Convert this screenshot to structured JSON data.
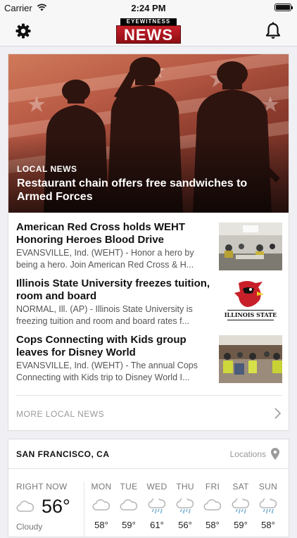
{
  "status_bar": {
    "carrier": "Carrier",
    "time": "2:24 PM"
  },
  "navbar": {
    "logo_top": "EYEWITNESS",
    "logo_main": "NEWS"
  },
  "hero": {
    "kicker": "LOCAL NEWS",
    "headline": "Restaurant chain offers free sandwiches to Armed Forces"
  },
  "stories": [
    {
      "title": "American Red Cross holds WEHT Honoring Heroes Blood Drive",
      "desc": "EVANSVILLE, Ind. (WEHT) - Honor a hero by being a hero. Join American Red Cross & H..."
    },
    {
      "title": "Illinois State University freezes tuition, room and board",
      "desc": "NORMAL, Ill. (AP) - Illinois State University is freezing tuition and room and board rates f..."
    },
    {
      "title": "Cops Connecting with Kids group leaves for Disney World",
      "desc": "EVANSVILLE, Ind. (WEHT) - The annual Cops Connecting with Kids trip to Disney World I..."
    }
  ],
  "thumb2_caption": "ILLINOIS STATE",
  "more_label": "MORE LOCAL NEWS",
  "weather": {
    "location": "SAN FRANCISCO, CA",
    "locations_label": "Locations",
    "now_label": "RIGHT NOW",
    "now_temp": "56°",
    "now_cond": "Cloudy",
    "days": [
      {
        "name": "MON",
        "temp": "58°",
        "icon": "cloud-icon"
      },
      {
        "name": "TUE",
        "temp": "59°",
        "icon": "cloud-icon"
      },
      {
        "name": "WED",
        "temp": "61°",
        "icon": "rain-icon"
      },
      {
        "name": "THU",
        "temp": "56°",
        "icon": "rain-icon"
      },
      {
        "name": "FRI",
        "temp": "58°",
        "icon": "cloud-icon"
      },
      {
        "name": "SAT",
        "temp": "59°",
        "icon": "rain-icon"
      },
      {
        "name": "SUN",
        "temp": "58°",
        "icon": "rain-icon"
      }
    ]
  },
  "colors": {
    "brand_red": "#c8202a",
    "icon_gray": "#9b9b9b",
    "rain_blue": "#7fb3d5"
  }
}
